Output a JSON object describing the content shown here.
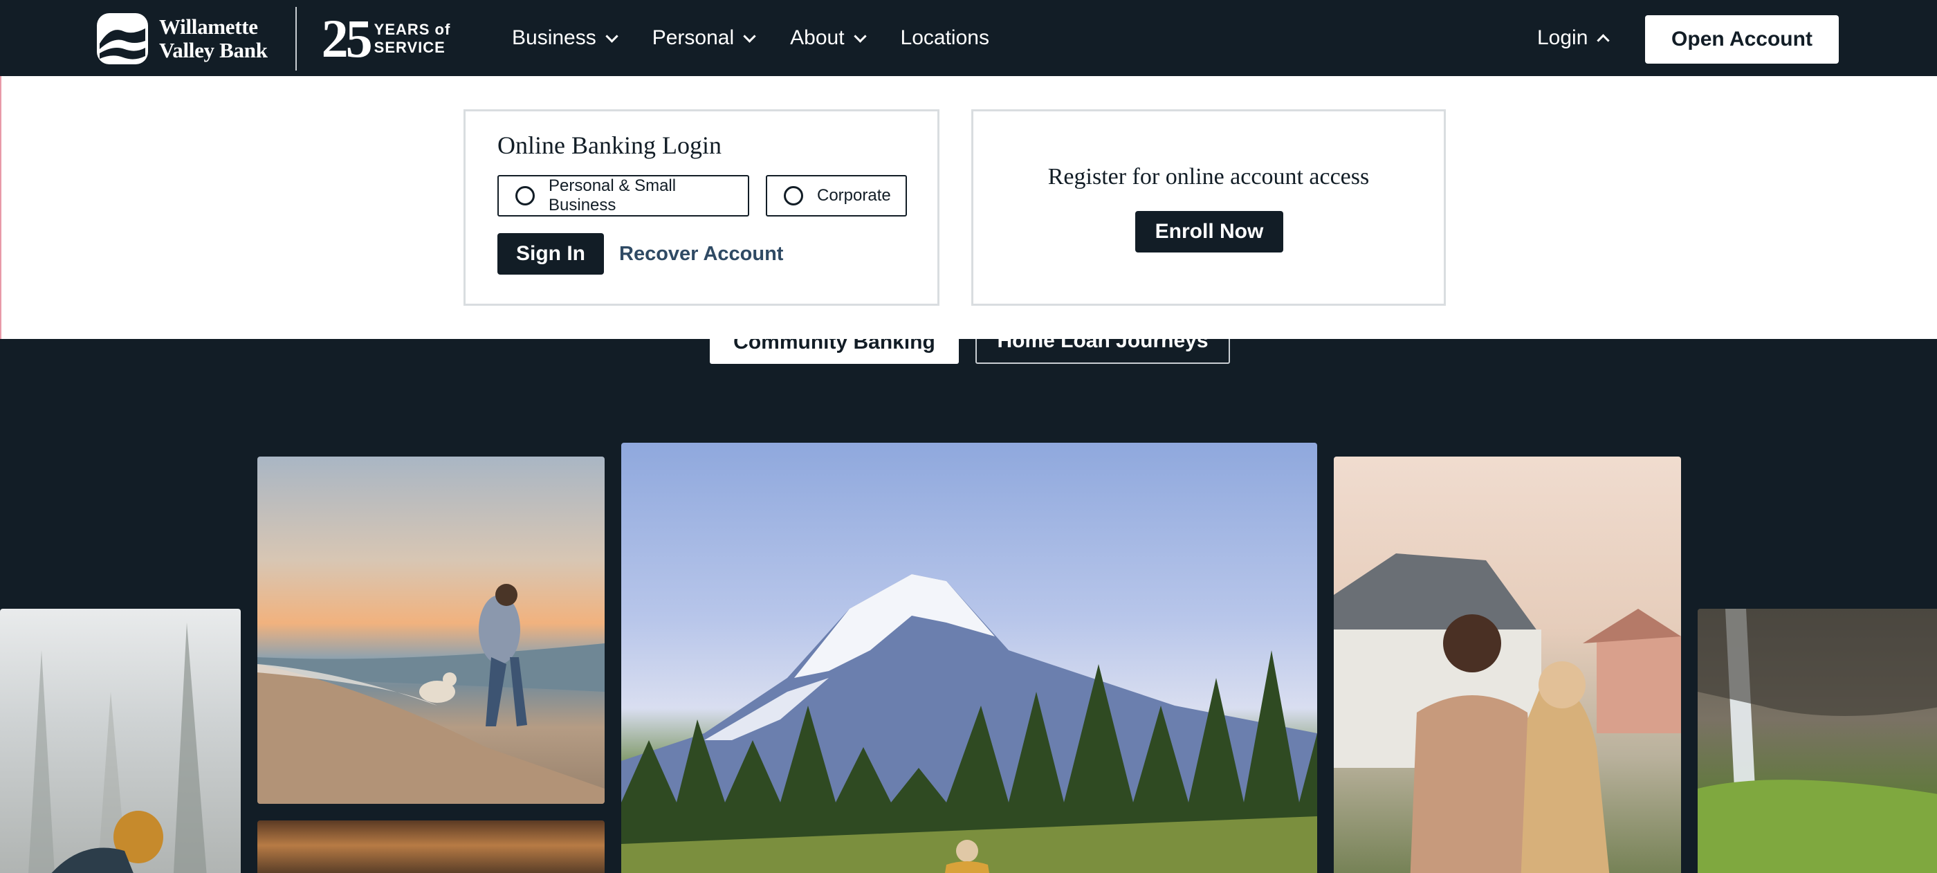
{
  "nav": {
    "brand_line1": "Willamette",
    "brand_line2": "Valley Bank",
    "anniversary_number": "25",
    "anniversary_line1": "YEARS of",
    "anniversary_line2": "SERVICE",
    "menu": [
      {
        "label": "Business",
        "has_dropdown": true
      },
      {
        "label": "Personal",
        "has_dropdown": true
      },
      {
        "label": "About",
        "has_dropdown": true
      },
      {
        "label": "Locations",
        "has_dropdown": false
      }
    ],
    "login_label": "Login",
    "open_account_label": "Open Account"
  },
  "login_panel": {
    "title": "Online Banking Login",
    "options": [
      "Personal & Small Business",
      "Corporate"
    ],
    "sign_in_label": "Sign In",
    "recover_label": "Recover Account"
  },
  "register_panel": {
    "title": "Register for online account access",
    "enroll_label": "Enroll Now"
  },
  "tabs": [
    "Community Banking",
    "Home Loan Journeys"
  ],
  "colors": {
    "navy": "#121d26",
    "white": "#ffffff",
    "link": "#2f4a64",
    "border": "#d9dde0"
  }
}
